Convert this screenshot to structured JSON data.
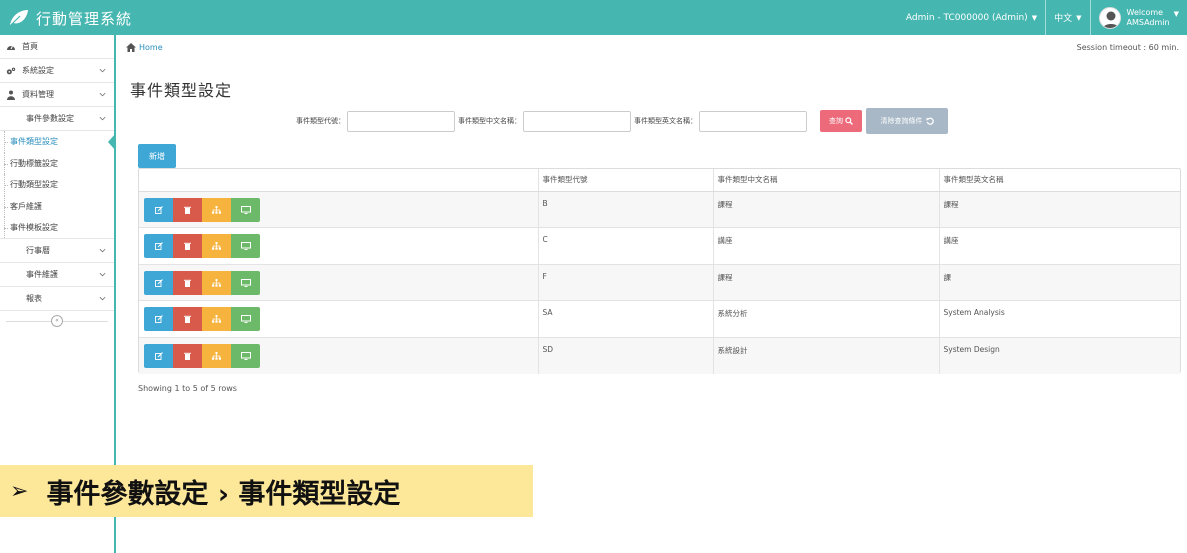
{
  "header": {
    "brand_title": "行動管理系統",
    "user_label": "Admin - TC000000 (Admin)",
    "language": "中文",
    "welcome": "Welcome",
    "username": "AMSAdmin",
    "bg_color": "#45b6b0"
  },
  "sidebar": {
    "items": [
      {
        "label": "首頁",
        "icon": "dashboard-icon"
      },
      {
        "label": "系統設定",
        "icon": "gears-icon"
      },
      {
        "label": "資料管理",
        "icon": "sitemap-icon"
      }
    ],
    "sub_group": "事件參數設定",
    "leaves": [
      "事件類型設定",
      "行動標籤設定",
      "行動類型設定",
      "客戶維護",
      "事件模板設定"
    ],
    "other_groups": [
      "行事曆",
      "事件維護",
      "報表"
    ]
  },
  "breadcrumb": {
    "home": "Home"
  },
  "session": "Session timeout : 60 min.",
  "page_title": "事件類型設定",
  "filters": {
    "code_label": "事件類型代號：",
    "zh_label": "事件類型中文名稱：",
    "en_label": "事件類型英文名稱：",
    "search_label": "查詢",
    "clear_label": "清除查詢條件"
  },
  "add_label": "新增",
  "table": {
    "columns": [
      "",
      "事件類型代號",
      "事件類型中文名稱",
      "事件類型英文名稱"
    ],
    "rows": [
      {
        "code": "B",
        "zh": "課程",
        "en": "課程"
      },
      {
        "code": "C",
        "zh": "講座",
        "en": "講座"
      },
      {
        "code": "F",
        "zh": "課程",
        "en": "課"
      },
      {
        "code": "SA",
        "zh": "系統分析",
        "en": "System Analysis"
      },
      {
        "code": "SD",
        "zh": "系統設計",
        "en": "System Design"
      }
    ]
  },
  "showing": "Showing 1 to 5 of 5 rows",
  "caption": {
    "arrow": "➢",
    "text": "事件參數設定 › 事件類型設定"
  }
}
